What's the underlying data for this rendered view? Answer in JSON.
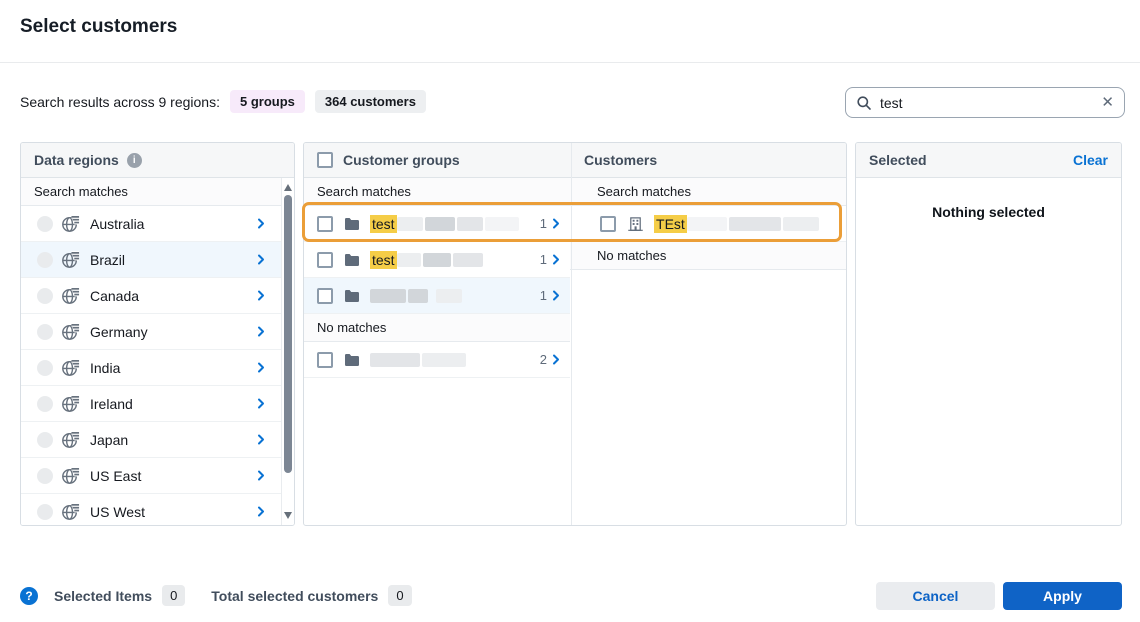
{
  "title": "Select customers",
  "summary": {
    "label": "Search results across 9 regions:",
    "groups_badge": "5 groups",
    "customers_badge": "364 customers"
  },
  "search": {
    "value": "test"
  },
  "icons": {
    "info": "i",
    "help": "?",
    "close": "✕"
  },
  "regions": {
    "title": "Data regions",
    "section_matches": "Search matches",
    "items": [
      "Australia",
      "Brazil",
      "Canada",
      "Germany",
      "India",
      "Ireland",
      "Japan",
      "US East",
      "US West"
    ]
  },
  "groups": {
    "title": "Customer groups",
    "section_matches": "Search matches",
    "section_no_matches": "No matches",
    "match_rows": [
      {
        "highlight": "test",
        "count": "1"
      },
      {
        "highlight": "test",
        "count": "1"
      },
      {
        "highlight": "",
        "count": "1"
      }
    ],
    "other_rows": [
      {
        "count": "2"
      }
    ]
  },
  "customers": {
    "title": "Customers",
    "section_matches": "Search matches",
    "section_no_matches": "No matches",
    "match_rows": [
      {
        "highlight": "TEst"
      }
    ]
  },
  "selected": {
    "title": "Selected",
    "clear_label": "Clear",
    "empty_text": "Nothing selected"
  },
  "footer": {
    "selected_items_label": "Selected Items",
    "selected_items_count": "0",
    "total_customers_label": "Total selected customers",
    "total_customers_count": "0",
    "cancel_label": "Cancel",
    "apply_label": "Apply"
  },
  "colors": {
    "accent_blue": "#0972d3",
    "apply_blue": "#0f63c6",
    "highlight_yellow": "#f5cd47",
    "annotation_orange": "#eb9e38",
    "selected_row_blue": "#f0f7fd",
    "groups_badge_bg": "#f7eafa",
    "customers_badge_bg": "#edeff1"
  }
}
